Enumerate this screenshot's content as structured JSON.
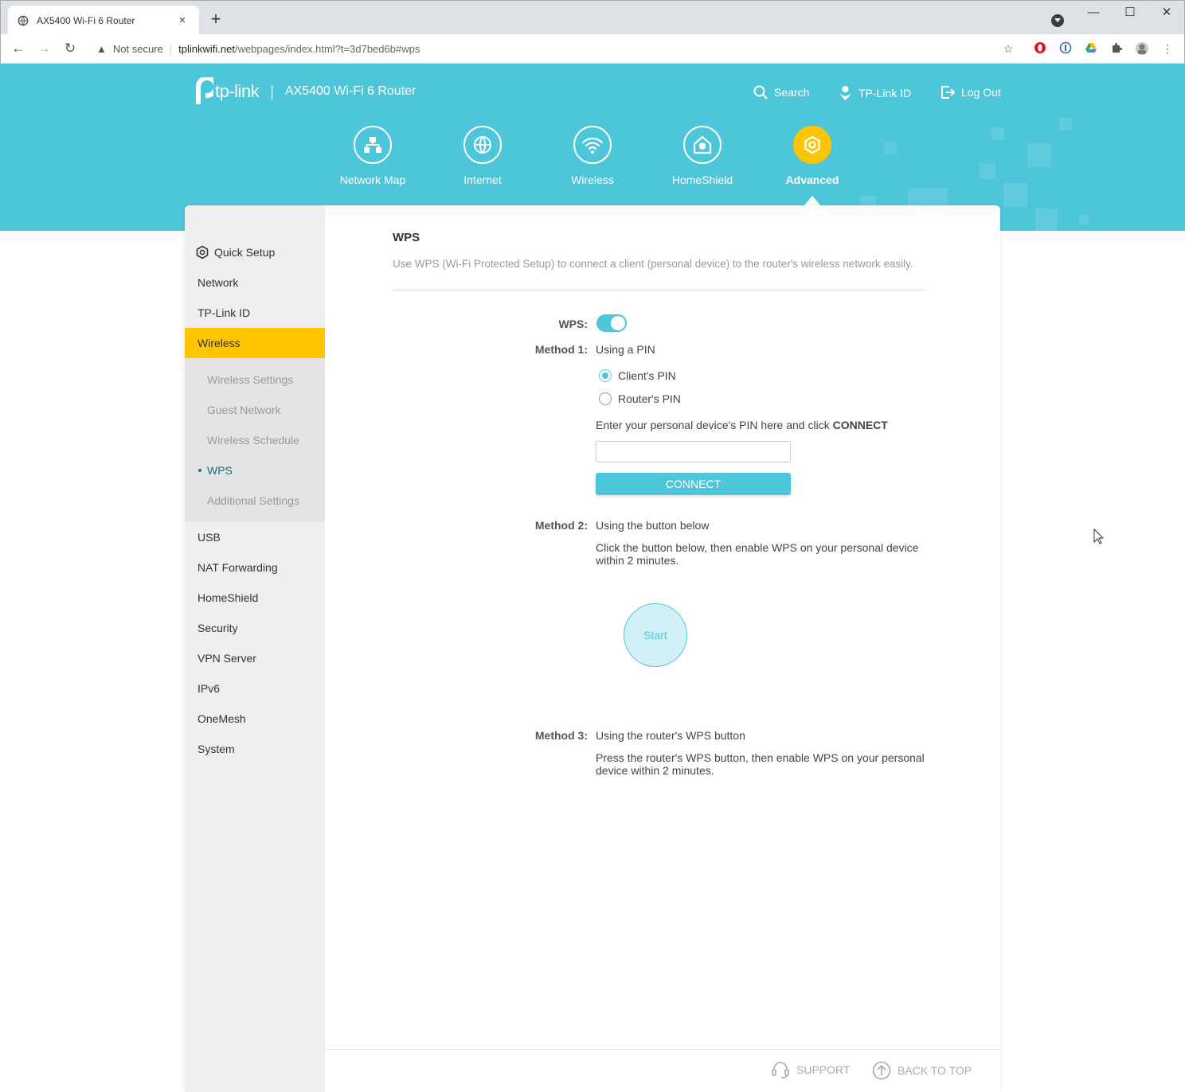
{
  "browser": {
    "tab_title": "AX5400 Wi-Fi 6 Router",
    "tab_close": "×",
    "new_tab": "+",
    "window_minimize": "—",
    "window_maximize": "☐",
    "window_close": "✕",
    "security_label": "Not secure",
    "url_host": "tplinkwifi.net",
    "url_path": "/webpages/index.html?t=3d7bed6b#wps"
  },
  "header": {
    "logo_text": "tp-link",
    "separator": "|",
    "model": "AX5400 Wi-Fi 6 Router",
    "search": "Search",
    "tplink_id": "TP-Link ID",
    "logout": "Log Out"
  },
  "main_nav": [
    {
      "label": "Network Map",
      "icon": "network-map-icon"
    },
    {
      "label": "Internet",
      "icon": "globe-icon"
    },
    {
      "label": "Wireless",
      "icon": "wifi-icon"
    },
    {
      "label": "HomeShield",
      "icon": "homeshield-icon"
    },
    {
      "label": "Advanced",
      "icon": "gear-icon",
      "active": true
    }
  ],
  "sidebar": {
    "items": [
      {
        "label": "Quick Setup",
        "icon": "gear-icon"
      },
      {
        "label": "Network"
      },
      {
        "label": "TP-Link ID"
      },
      {
        "label": "Wireless",
        "active": true
      },
      {
        "label": "USB"
      },
      {
        "label": "NAT Forwarding"
      },
      {
        "label": "HomeShield"
      },
      {
        "label": "Security"
      },
      {
        "label": "VPN Server"
      },
      {
        "label": "IPv6"
      },
      {
        "label": "OneMesh"
      },
      {
        "label": "System"
      }
    ],
    "wireless_sub": [
      {
        "label": "Wireless Settings"
      },
      {
        "label": "Guest Network"
      },
      {
        "label": "Wireless Schedule"
      },
      {
        "label": "WPS",
        "active": true
      },
      {
        "label": "Additional Settings"
      }
    ]
  },
  "wps": {
    "title": "WPS",
    "description": "Use WPS (Wi-Fi Protected Setup) to connect a client (personal device) to the router's wireless network easily.",
    "toggle_label": "WPS:",
    "toggle_on": true,
    "method1_label": "Method 1:",
    "method1_text": "Using a PIN",
    "radio_client": "Client's PIN",
    "radio_router": "Router's PIN",
    "selected_radio": "Client's PIN",
    "pin_prompt": "Enter your personal device's PIN here and click ",
    "pin_prompt_bold": "CONNECT",
    "pin_value": "",
    "connect_button": "CONNECT",
    "method2_label": "Method 2:",
    "method2_text": "Using the button below",
    "method2_desc": "Click the button below, then enable WPS on your personal device within 2 minutes.",
    "start_button": "Start",
    "method3_label": "Method 3:",
    "method3_text": "Using the router's WPS button",
    "method3_desc": "Press the router's WPS button, then enable WPS on your personal device within 2 minutes."
  },
  "footer": {
    "support": "SUPPORT",
    "back_to_top": "BACK TO TOP"
  },
  "colors": {
    "brand": "#4ec6da",
    "accent": "#ffc600"
  }
}
